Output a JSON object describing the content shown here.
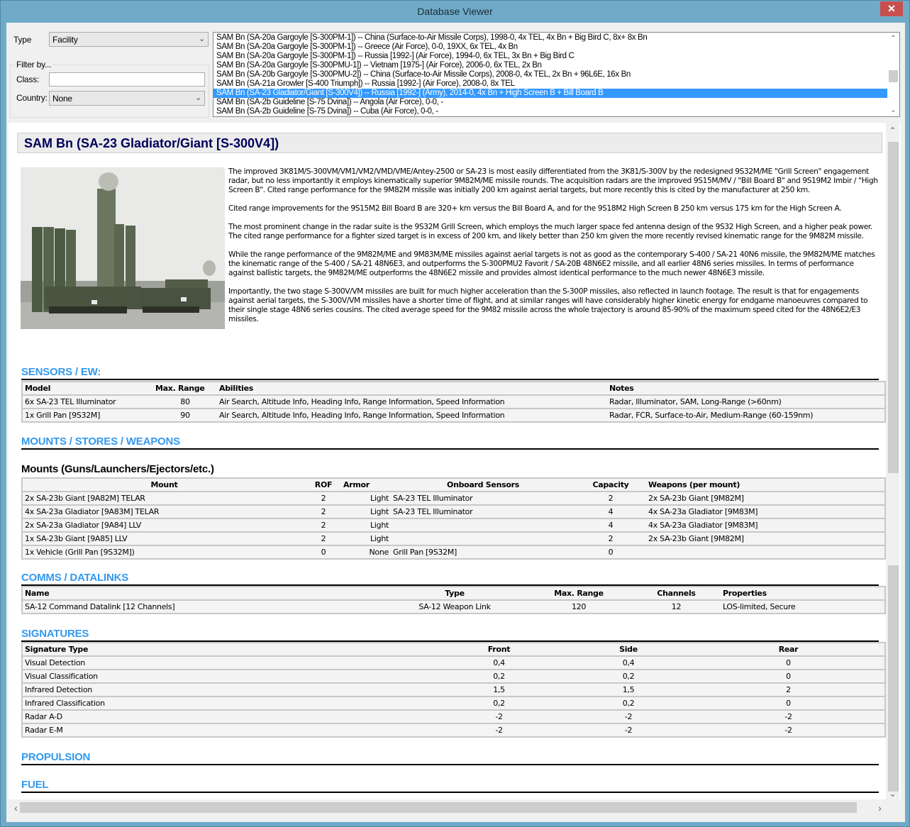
{
  "window": {
    "title": "Database Viewer",
    "close_icon": "close-icon"
  },
  "filters": {
    "type_label": "Type",
    "type_value": "Facility",
    "filter_group_label": "Filter by...",
    "class_label": "Class:",
    "class_value": "",
    "country_label": "Country:",
    "country_value": "None"
  },
  "results": {
    "selected_index": 6,
    "items": [
      "SAM Bn (SA-20a Gargoyle [S-300PM-1]) -- China (Surface-to-Air Missile Corps), 1998-0, 4x TEL, 4x Bn + Big Bird C, 8x+ 8x Bn",
      "SAM Bn (SA-20a Gargoyle [S-300PM-1]) -- Greece (Air Force), 0-0, 19XX, 6x TEL, 4x Bn",
      "SAM Bn (SA-20a Gargoyle [S-300PM-1]) -- Russia [1992-] (Air Force), 1994-0, 6x TEL, 3x Bn + Big Bird C",
      "SAM Bn (SA-20a Gargoyle [S-300PMU-1]) -- Vietnam [1975-] (Air Force), 2006-0, 6x TEL, 2x Bn",
      "SAM Bn (SA-20b Gargoyle [S-300PMU-2]) -- China (Surface-to-Air Missile Corps), 2008-0, 4x TEL, 2x Bn + 96L6E, 16x Bn",
      "SAM Bn (SA-21a Growler [S-400 Triumph]) -- Russia [1992-] (Air Force), 2008-0, 8x TEL",
      "SAM Bn (SA-23 Gladiator/Giant [S-300V4]) -- Russia [1992-] (Army), 2014-0, 4x Bn + High Screen B + Bill Board B",
      "SAM Bn (SA-2b Guideline [S-75 Dvina]) -- Angola (Air Force), 0-0, -",
      "SAM Bn (SA-2b Guideline [S-75 Dvina]) -- Cuba (Air Force), 0-0, -"
    ]
  },
  "detail": {
    "title": "SAM Bn (SA-23 Gladiator/Giant [S-300V4])",
    "image_alt": "S-300V4 launcher vehicles photo",
    "paragraphs": [
      "The improved 3K81M/S-300VM/VM1/VM2/VMD/VME/Antey-2500 or SA-23 is most easily differentiated from the 3K81/S-300V by the redesigned 9S32M/ME \"Grill Screen\" engagement radar, but no less importantly it employs kinematically superior 9M82M/ME missile rounds. The acquisition radars are the improved 9S15M/MV / \"Bill Board B\" and 9S19M2 Imbir / \"High Screen B\". Cited range performance for the 9M82M missile was initially 200 km against aerial targets, but more recently this is cited by the manufacturer at 250 km.",
      "Cited range improvements for the 9S15M2 Bill Board B are 320+ km versus the Bill Board A, and for the 9S18M2 High Screen B 250 km versus 175 km for the High Screen A.",
      "The most prominent change in the radar suite is the 9S32M Grill Screen, which employs the much larger space fed antenna design of the 9S32 High Screen, and a higher peak power. The cited range performance for a fighter sized target is in excess of 200 km, and likely better than 250 km given the more recently revised kinematic range for the 9M82M missile.",
      "While the range performance of the 9M82M/ME and 9M83M/ME missiles against aerial targets is not as good as the contemporary S-400 / SA-21 40N6 missile, the 9M82M/ME matches the kinematic range of the S-400 / SA-21 48N6E3, and outperforms the S-300PMU2 Favorit / SA-20B 48N6E2 missile, and all earlier 48N6 series missiles. In terms of performance against ballistic targets, the 9M82M/ME outperforms the 48N6E2 missile and provides almost identical performance to the much newer 48N6E3 missile.",
      "Importantly, the two stage S-300V/VM missiles are built for much higher acceleration than the S-300P missiles, also reflected in launch footage. The result is that for engagements against aerial targets, the S-300V/VM missiles have a shorter time of flight, and at similar ranges will have considerably higher kinetic energy for endgame manoeuvres compared to their single stage 48N6 series cousins. The cited average speed for the 9M82 missile across the whole trajectory is around 85-90% of the maximum speed cited for the 48N6E2/E3 missiles."
    ]
  },
  "sensors": {
    "heading": "SENSORS / EW:",
    "columns": [
      "Model",
      "Max. Range",
      "Abilities",
      "Notes"
    ],
    "rows": [
      [
        "6x SA-23 TEL Illuminator",
        "80",
        "Air Search, Altitude Info, Heading Info, Range Information, Speed Information",
        "Radar, Illuminator, SAM, Long-Range (>60nm)"
      ],
      [
        "1x Grill Pan [9S32M]",
        "90",
        "Air Search, Altitude Info, Heading Info, Range Information, Speed Information",
        "Radar, FCR, Surface-to-Air, Medium-Range (60-159nm)"
      ]
    ]
  },
  "mounts_section": {
    "heading": "MOUNTS / STORES / WEAPONS",
    "subheading": "Mounts (Guns/Launchers/Ejectors/etc.)",
    "columns": [
      "Mount",
      "ROF",
      "Armor",
      "Onboard Sensors",
      "Capacity",
      "Weapons (per mount)"
    ],
    "rows": [
      [
        "2x SA-23b Giant [9A82M] TELAR",
        "2",
        "Light",
        "SA-23 TEL Illuminator",
        "2",
        "2x SA-23b Giant [9M82M]"
      ],
      [
        "4x SA-23a Gladiator [9A83M] TELAR",
        "2",
        "Light",
        "SA-23 TEL Illuminator",
        "4",
        "4x SA-23a Gladiator [9M83M]"
      ],
      [
        "2x SA-23a Gladiator [9A84] LLV",
        "2",
        "Light",
        "",
        "4",
        "4x SA-23a Gladiator [9M83M]"
      ],
      [
        "1x SA-23b Giant [9A85] LLV",
        "2",
        "Light",
        "",
        "2",
        "2x SA-23b Giant [9M82M]"
      ],
      [
        "1x Vehicle (Grill Pan [9S32M])",
        "0",
        "None",
        "Grill Pan [9S32M]",
        "0",
        ""
      ]
    ]
  },
  "comms": {
    "heading": "COMMS / DATALINKS",
    "columns": [
      "Name",
      "Type",
      "Max. Range",
      "Channels",
      "Properties"
    ],
    "rows": [
      [
        "SA-12 Command Datalink [12 Channels]",
        "SA-12 Weapon Link",
        "120",
        "12",
        "LOS-limited, Secure"
      ]
    ]
  },
  "signatures": {
    "heading": "SIGNATURES",
    "columns": [
      "Signature Type",
      "Front",
      "Side",
      "Rear"
    ],
    "rows": [
      [
        "Visual Detection",
        "0,4",
        "0,4",
        "0"
      ],
      [
        "Visual Classification",
        "0,2",
        "0,2",
        "0"
      ],
      [
        "Infrared Detection",
        "1,5",
        "1,5",
        "2"
      ],
      [
        "Infrared Classification",
        "0,2",
        "0,2",
        "0"
      ],
      [
        "Radar A-D",
        "-2",
        "-2",
        "-2"
      ],
      [
        "Radar E-M",
        "-2",
        "-2",
        "-2"
      ]
    ]
  },
  "propulsion": {
    "heading": "PROPULSION"
  },
  "fuel": {
    "heading": "FUEL"
  },
  "icons": {
    "close": "✕",
    "combo_arrow": "⌄",
    "scroll_up": "⌃",
    "scroll_down": "⌄",
    "scroll_left": "‹",
    "scroll_right": "›"
  }
}
